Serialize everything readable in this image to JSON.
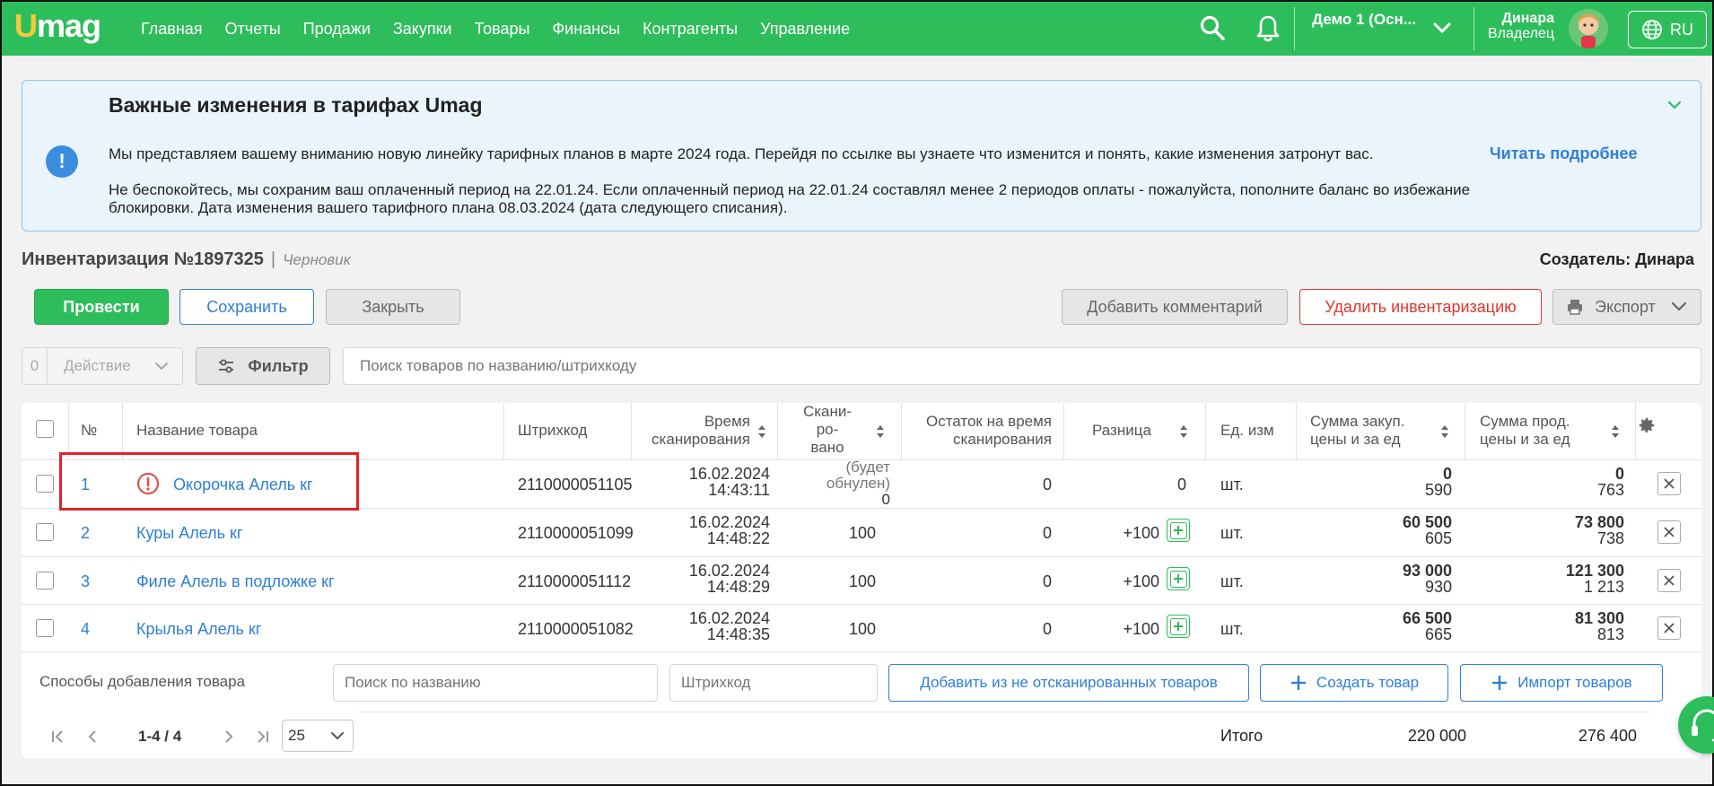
{
  "topbar": {
    "logo": "mag",
    "logo_u": "U",
    "nav": [
      "Главная",
      "Отчеты",
      "Продажи",
      "Закупки",
      "Товары",
      "Финансы",
      "Контрагенты",
      "Управление"
    ],
    "company": "Демо 1 (Осн...",
    "user_name": "Динара",
    "user_role": "Владелец",
    "lang": "RU",
    "accent_color": "#2ebd5b"
  },
  "notice": {
    "title": "Важные изменения в тарифах Umag",
    "p1": "Мы представляем вашему вниманию новую линейку тарифных планов в марте 2024 года. Перейдя по ссылке вы узнаете что изменится и понять, какие изменения затронут вас.",
    "link": "Читать подробнее",
    "p2": "Не беспокойтесь, мы сохраним ваш оплаченный период на 22.01.24. Если оплаченный период на 22.01.24 составлял менее 2 периодов оплаты - пожалуйста, пополните баланс во избежание блокировки. Дата изменения вашего тарифного плана 08.03.2024 (дата следующего списания)."
  },
  "doc": {
    "title": "Инвентаризация №1897325",
    "status": "Черновик",
    "author": "Создатель: Динара"
  },
  "buttons": {
    "conduct": "Провести",
    "save": "Сохранить",
    "close": "Закрыть",
    "add_comment": "Добавить комментарий",
    "delete": "Удалить инвентаризацию",
    "export": "Экспорт"
  },
  "toolbar": {
    "selected_count": "0",
    "action": "Действие",
    "filter": "Фильтр",
    "search_placeholder": "Поиск товаров по названию/штрихкоду"
  },
  "table": {
    "headers": {
      "num": "№",
      "name": "Название товара",
      "barcode": "Штрихкод",
      "scan_time_1": "Время",
      "scan_time_2": "сканирования",
      "scanned_1": "Скани-",
      "scanned_2": "ро-",
      "scanned_3": "вано",
      "stock_1": "Остаток на время",
      "stock_2": "сканирования",
      "diff": "Разница",
      "unit": "Ед. изм",
      "purchase_1": "Сумма закуп.",
      "purchase_2": "цены и за ед",
      "sale_1": "Сумма прод.",
      "sale_2": "цены и за ед"
    },
    "rows": [
      {
        "num": "1",
        "name": "Окорочка Алель кг",
        "barcode": "2110000051105",
        "date": "16.02.2024",
        "time": "14:43:11",
        "scanned_1": "(будет",
        "scanned_2": "обнулен)",
        "scanned_3": "0",
        "stock": "0",
        "diff": "0",
        "unit": "шт.",
        "purchase_total": "0",
        "purchase_unit": "590",
        "sale_total": "0",
        "sale_unit": "763"
      },
      {
        "num": "2",
        "name": "Куры Алель кг",
        "barcode": "2110000051099",
        "date": "16.02.2024",
        "time": "14:48:22",
        "scanned": "100",
        "stock": "0",
        "diff": "+100",
        "unit": "шт.",
        "purchase_total": "60 500",
        "purchase_unit": "605",
        "sale_total": "73 800",
        "sale_unit": "738"
      },
      {
        "num": "3",
        "name": "Филе Алель в подложке кг",
        "barcode": "2110000051112",
        "date": "16.02.2024",
        "time": "14:48:29",
        "scanned": "100",
        "stock": "0",
        "diff": "+100",
        "unit": "шт.",
        "purchase_total": "93 000",
        "purchase_unit": "930",
        "sale_total": "121 300",
        "sale_unit": "1 213"
      },
      {
        "num": "4",
        "name": "Крылья Алель кг",
        "barcode": "2110000051082",
        "date": "16.02.2024",
        "time": "14:48:35",
        "scanned": "100",
        "stock": "0",
        "diff": "+100",
        "unit": "шт.",
        "purchase_total": "66 500",
        "purchase_unit": "665",
        "sale_total": "81 300",
        "sale_unit": "813"
      }
    ]
  },
  "add_section": {
    "label": "Способы добавления товара",
    "name_placeholder": "Поиск по названию",
    "barcode_placeholder": "Штрихкод",
    "add_unscanned": "Добавить из не отсканированных товаров",
    "create": "Создать товар",
    "import": "Импорт товаров"
  },
  "pager": {
    "range": "1-4 / 4",
    "per_page": "25"
  },
  "totals": {
    "label": "Итого",
    "purchase": "220 000",
    "sale": "276 400"
  }
}
